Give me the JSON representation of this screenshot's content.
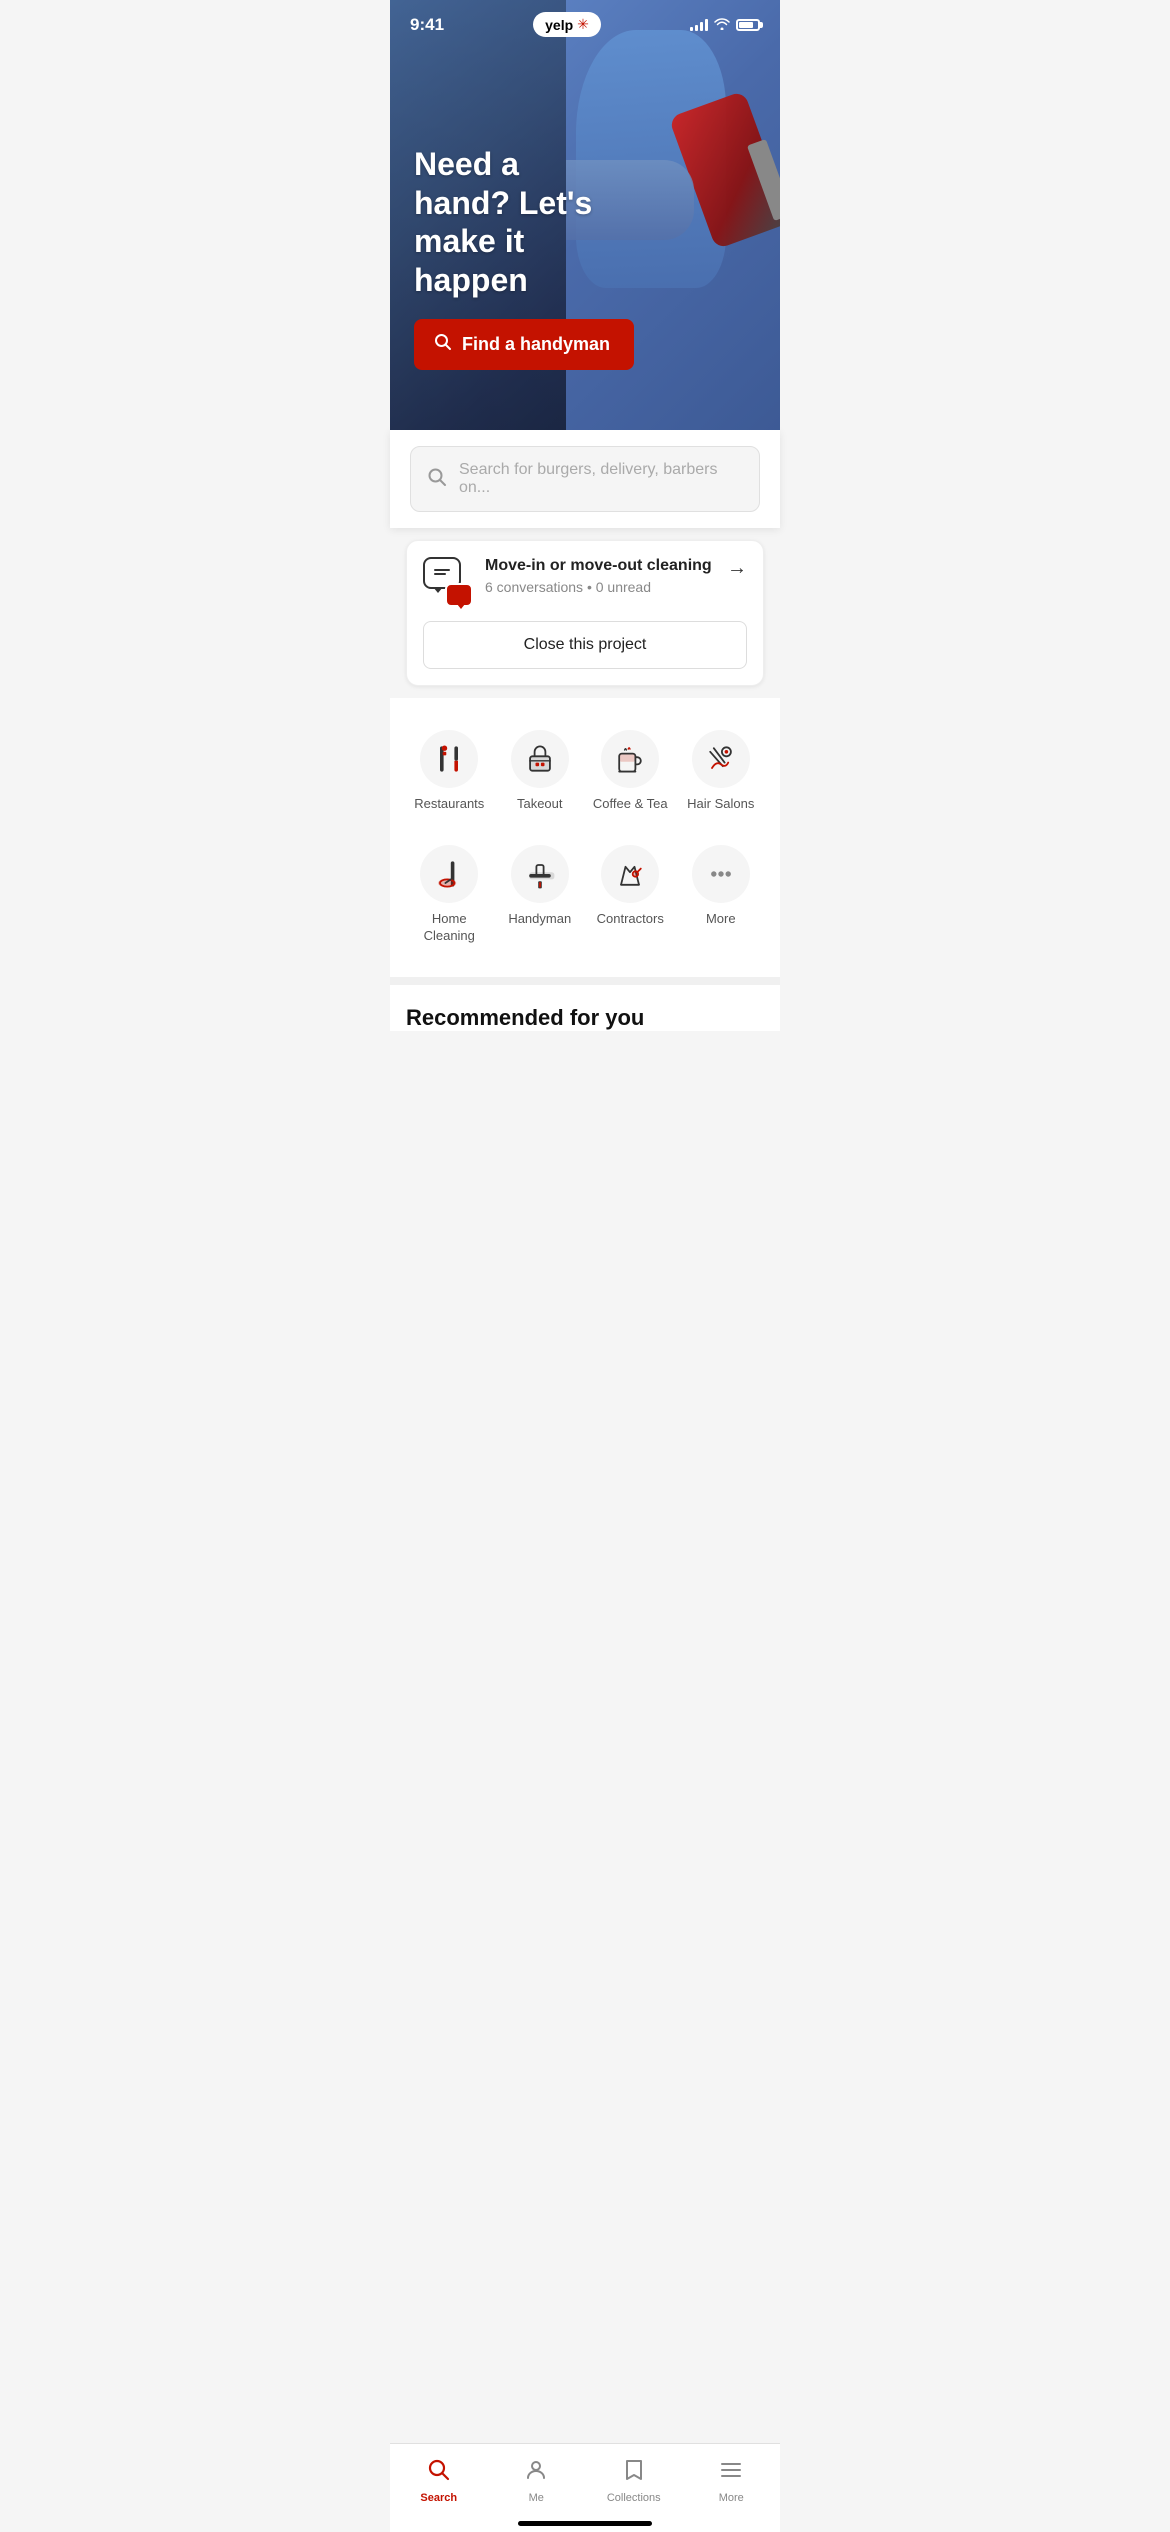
{
  "statusBar": {
    "time": "9:41",
    "logoText": "yelp",
    "logoStar": "✳"
  },
  "hero": {
    "title": "Need a hand? Let's make it happen",
    "buttonLabel": "Find a handyman",
    "buttonIcon": "🔍"
  },
  "search": {
    "placeholder": "Search for burgers, delivery, barbers on..."
  },
  "projectCard": {
    "title": "Move-in or move-out cleaning",
    "meta": "6 conversations • 0 unread",
    "closeLabel": "Close this project"
  },
  "categories": [
    {
      "id": "restaurants",
      "label": "Restaurants"
    },
    {
      "id": "takeout",
      "label": "Takeout"
    },
    {
      "id": "coffee-tea",
      "label": "Coffee & Tea"
    },
    {
      "id": "hair-salons",
      "label": "Hair Salons"
    },
    {
      "id": "home-cleaning",
      "label": "Home Cleaning"
    },
    {
      "id": "handyman",
      "label": "Handyman"
    },
    {
      "id": "contractors",
      "label": "Contractors"
    },
    {
      "id": "more",
      "label": "More"
    }
  ],
  "recommended": {
    "title": "Recommended for you"
  },
  "bottomNav": [
    {
      "id": "search",
      "label": "Search",
      "active": true
    },
    {
      "id": "me",
      "label": "Me",
      "active": false
    },
    {
      "id": "collections",
      "label": "Collections",
      "active": false
    },
    {
      "id": "more",
      "label": "More",
      "active": false
    }
  ]
}
